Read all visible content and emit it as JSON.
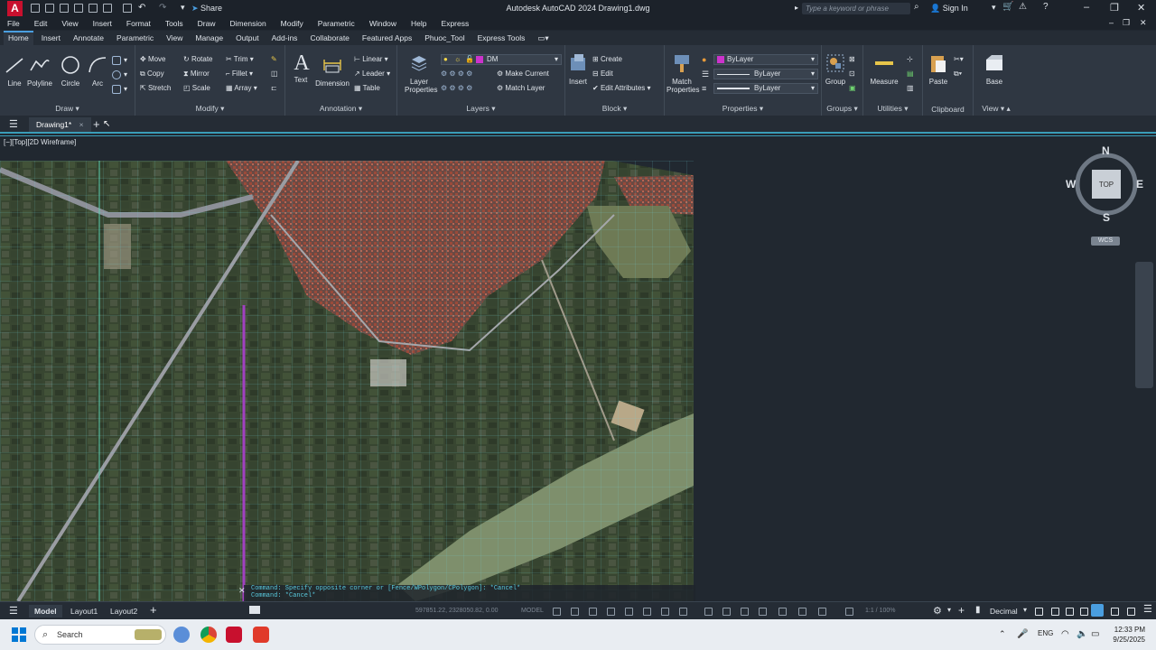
{
  "titlebar": {
    "app_logo": "A",
    "share": "Share",
    "title": "Autodesk AutoCAD 2024   Drawing1.dwg",
    "search_placeholder": "Type a keyword or phrase",
    "sign_in": "Sign In"
  },
  "menu": [
    "File",
    "Edit",
    "View",
    "Insert",
    "Format",
    "Tools",
    "Draw",
    "Dimension",
    "Modify",
    "Parametric",
    "Window",
    "Help",
    "Express"
  ],
  "ribbon_tabs": [
    "Home",
    "Insert",
    "Annotate",
    "Parametric",
    "View",
    "Manage",
    "Output",
    "Add-ins",
    "Collaborate",
    "Featured Apps",
    "Phuoc_Tool",
    "Express Tools"
  ],
  "ribbon": {
    "draw": {
      "title": "Draw",
      "line": "Line",
      "polyline": "Polyline",
      "circle": "Circle",
      "arc": "Arc"
    },
    "modify": {
      "title": "Modify",
      "move": "Move",
      "rotate": "Rotate",
      "trim": "Trim",
      "copy": "Copy",
      "mirror": "Mirror",
      "fillet": "Fillet",
      "stretch": "Stretch",
      "scale": "Scale",
      "array": "Array"
    },
    "annotation": {
      "title": "Annotation",
      "text": "Text",
      "dimension": "Dimension",
      "linear": "Linear",
      "leader": "Leader",
      "table": "Table"
    },
    "layers": {
      "title": "Layers",
      "layer_properties": "Layer Properties",
      "current_layer": "DM",
      "make_current": "Make Current",
      "match_layer": "Match Layer"
    },
    "block": {
      "title": "Block",
      "insert": "Insert",
      "create": "Create",
      "edit": "Edit",
      "edit_attributes": "Edit Attributes"
    },
    "properties": {
      "title": "Properties",
      "match_properties": "Match Properties",
      "color": "ByLayer",
      "linetype": "ByLayer",
      "lineweight": "ByLayer"
    },
    "groups": {
      "title": "Groups",
      "group": "Group"
    },
    "utilities": {
      "title": "Utilities",
      "measure": "Measure"
    },
    "clipboard": {
      "title": "Clipboard",
      "paste": "Paste"
    },
    "view": {
      "title": "View",
      "base": "Base"
    }
  },
  "doc_tab": "Drawing1*",
  "viewport_label": "[−][Top][2D Wireframe]",
  "viewcube": {
    "n": "N",
    "s": "S",
    "e": "E",
    "w": "W",
    "face": "TOP",
    "wcs": "WCS"
  },
  "command_lines": [
    "Command: Specify opposite corner or [Fence/WPolygon/CPolygon]: *Cancel*",
    "Command: *Cancel*"
  ],
  "status": {
    "model": "Model",
    "layout1": "Layout1",
    "layout2": "Layout2",
    "coords": "597851.22, 2328050.82, 0.00",
    "space": "MODEL",
    "scale": "1:1 / 100%",
    "units": "Decimal"
  },
  "taskbar": {
    "search": "Search",
    "lang": "ENG",
    "time": "12:33 PM",
    "date": "9/25/2025"
  },
  "colors": {
    "accent": "#4a9ee0",
    "layer_swatch": "#cc33cc",
    "cmd_text": "#58c8dc",
    "grid_line": "#6fd3d8"
  }
}
